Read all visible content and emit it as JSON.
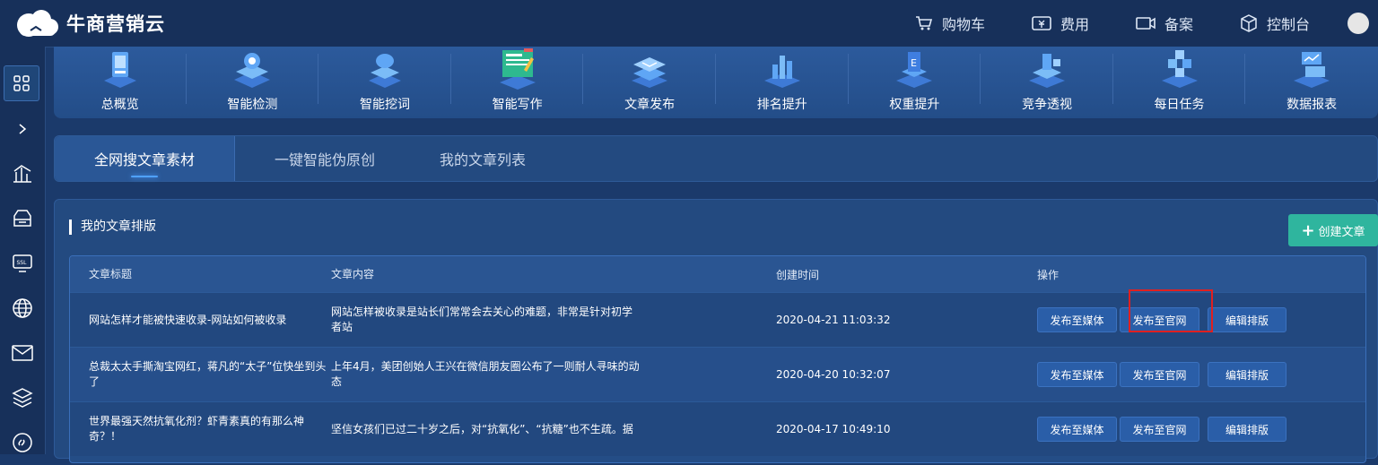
{
  "brand": {
    "name": "牛商营销云"
  },
  "topnav": [
    {
      "label": "购物车",
      "icon": "cart-icon"
    },
    {
      "label": "费用",
      "icon": "ticket-icon"
    },
    {
      "label": "备案",
      "icon": "camera-icon"
    },
    {
      "label": "控制台",
      "icon": "cube-icon"
    }
  ],
  "sidebar": [
    "grid-icon",
    "chevron-right-icon",
    "chart-icon",
    "cloud-icon",
    "ssl-icon",
    "globe-icon",
    "mail-icon",
    "layers-icon",
    "link-icon"
  ],
  "modules": [
    {
      "label": "总概览"
    },
    {
      "label": "智能检测"
    },
    {
      "label": "智能挖词"
    },
    {
      "label": "智能写作"
    },
    {
      "label": "文章发布"
    },
    {
      "label": "排名提升"
    },
    {
      "label": "权重提升"
    },
    {
      "label": "竞争透视"
    },
    {
      "label": "每日任务"
    },
    {
      "label": "数据报表"
    }
  ],
  "tabs": [
    {
      "label": "全网搜文章素材"
    },
    {
      "label": "一键智能伪原创"
    },
    {
      "label": "我的文章列表"
    }
  ],
  "panel": {
    "title": "我的文章排版",
    "create_label": "创建文章"
  },
  "table": {
    "headers": [
      "文章标题",
      "文章内容",
      "创建时间",
      "操作"
    ],
    "rows": [
      {
        "title": "网站怎样才能被快速收录-网站如何被收录",
        "content": "网站怎样被收录是站长们常常会去关心的难题，非常是针对初学者站",
        "time": "2020-04-21 11:03:32"
      },
      {
        "title": "总裁太太手撕淘宝网红，蒋凡的“太子”位快坐到头了",
        "content": "上年4月，美团创始人王兴在微信朋友圈公布了一则耐人寻味的动态",
        "time": "2020-04-20 10:32:07"
      },
      {
        "title": "世界最强天然抗氧化剂？虾青素真的有那么神奇？！",
        "content": "坚信女孩们已过二十岁之后，对“抗氧化”、“抗糖”也不生疏。据",
        "time": "2020-04-17 10:49:10"
      }
    ],
    "actions": {
      "media": "发布至媒体",
      "site": "发布至官网",
      "edit": "编辑排版"
    }
  },
  "colors": {
    "accent": "#2fb59e",
    "highlight": "#e02020",
    "bg": "#1b3a6b"
  }
}
